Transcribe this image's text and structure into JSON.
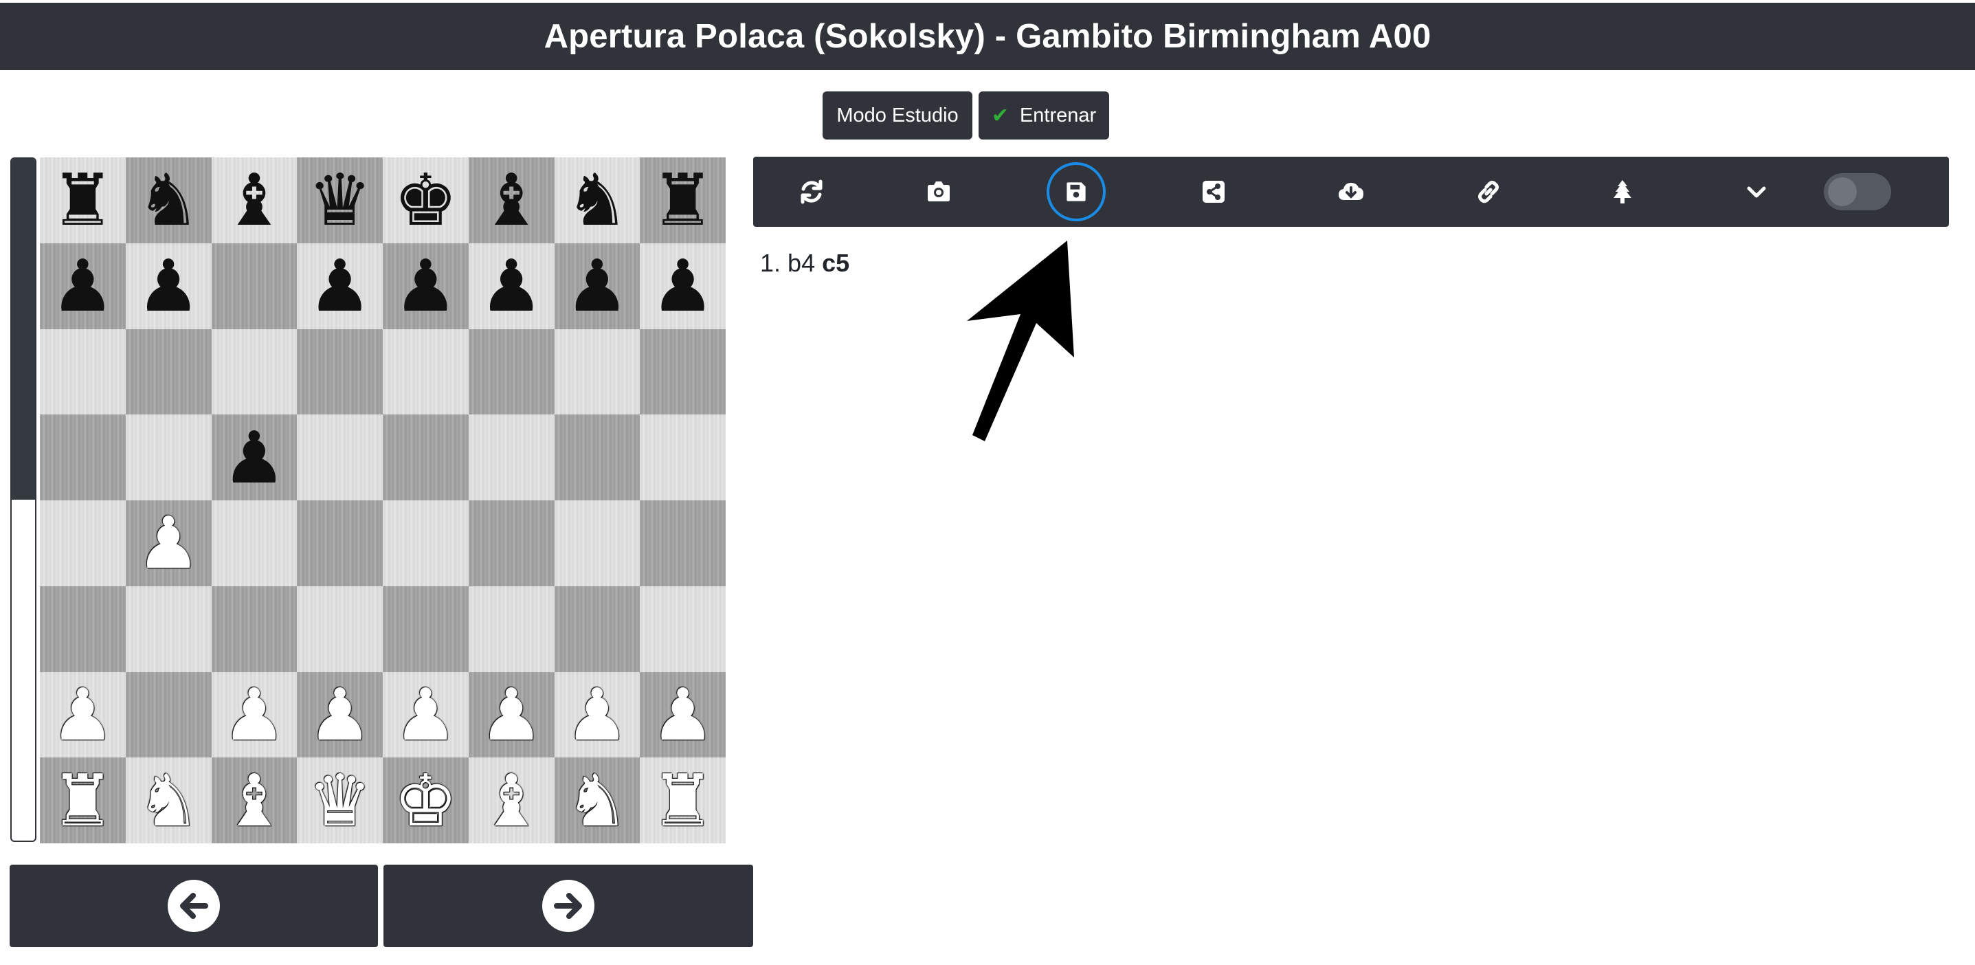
{
  "header": {
    "title": "Apertura Polaca (Sokolsky) - Gambito Birmingham A00"
  },
  "modes": {
    "study_label": "Modo Estudio",
    "train_label": "Entrenar"
  },
  "evaluation_bar": {
    "white_fraction": 0.5
  },
  "board": {
    "ranks": [
      [
        {
          "p": "♜",
          "c": "b"
        },
        {
          "p": "♞",
          "c": "b"
        },
        {
          "p": "♝",
          "c": "b"
        },
        {
          "p": "♛",
          "c": "b"
        },
        {
          "p": "♚",
          "c": "b"
        },
        {
          "p": "♝",
          "c": "b"
        },
        {
          "p": "♞",
          "c": "b"
        },
        {
          "p": "♜",
          "c": "b"
        }
      ],
      [
        {
          "p": "♟",
          "c": "b"
        },
        {
          "p": "♟",
          "c": "b"
        },
        null,
        {
          "p": "♟",
          "c": "b"
        },
        {
          "p": "♟",
          "c": "b"
        },
        {
          "p": "♟",
          "c": "b"
        },
        {
          "p": "♟",
          "c": "b"
        },
        {
          "p": "♟",
          "c": "b"
        }
      ],
      [
        null,
        null,
        null,
        null,
        null,
        null,
        null,
        null
      ],
      [
        null,
        null,
        {
          "p": "♟",
          "c": "b"
        },
        null,
        null,
        null,
        null,
        null
      ],
      [
        null,
        {
          "p": "♟",
          "c": "w"
        },
        null,
        null,
        null,
        null,
        null,
        null
      ],
      [
        null,
        null,
        null,
        null,
        null,
        null,
        null,
        null
      ],
      [
        {
          "p": "♟",
          "c": "w"
        },
        null,
        {
          "p": "♟",
          "c": "w"
        },
        {
          "p": "♟",
          "c": "w"
        },
        {
          "p": "♟",
          "c": "w"
        },
        {
          "p": "♟",
          "c": "w"
        },
        {
          "p": "♟",
          "c": "w"
        },
        {
          "p": "♟",
          "c": "w"
        }
      ],
      [
        {
          "p": "♜",
          "c": "w"
        },
        {
          "p": "♞",
          "c": "w"
        },
        {
          "p": "♝",
          "c": "w"
        },
        {
          "p": "♛",
          "c": "w"
        },
        {
          "p": "♚",
          "c": "w"
        },
        {
          "p": "♝",
          "c": "w"
        },
        {
          "p": "♞",
          "c": "w"
        },
        {
          "p": "♜",
          "c": "w"
        }
      ]
    ]
  },
  "toolbar": {
    "icons": [
      "sync-icon",
      "camera-icon",
      "save-icon",
      "share-icon",
      "cloud-download-icon",
      "link-icon",
      "tree-icon",
      "chevron-down-icon"
    ],
    "toggle_on": false
  },
  "moves": {
    "number": "1.",
    "white": "b4",
    "black": "c5"
  },
  "navigation": {
    "prev_icon": "arrow-left-icon",
    "next_icon": "arrow-right-icon"
  },
  "colors": {
    "dark_panel": "#30343a",
    "highlight_ring": "#1a8ce6",
    "check": "#2fae37"
  }
}
